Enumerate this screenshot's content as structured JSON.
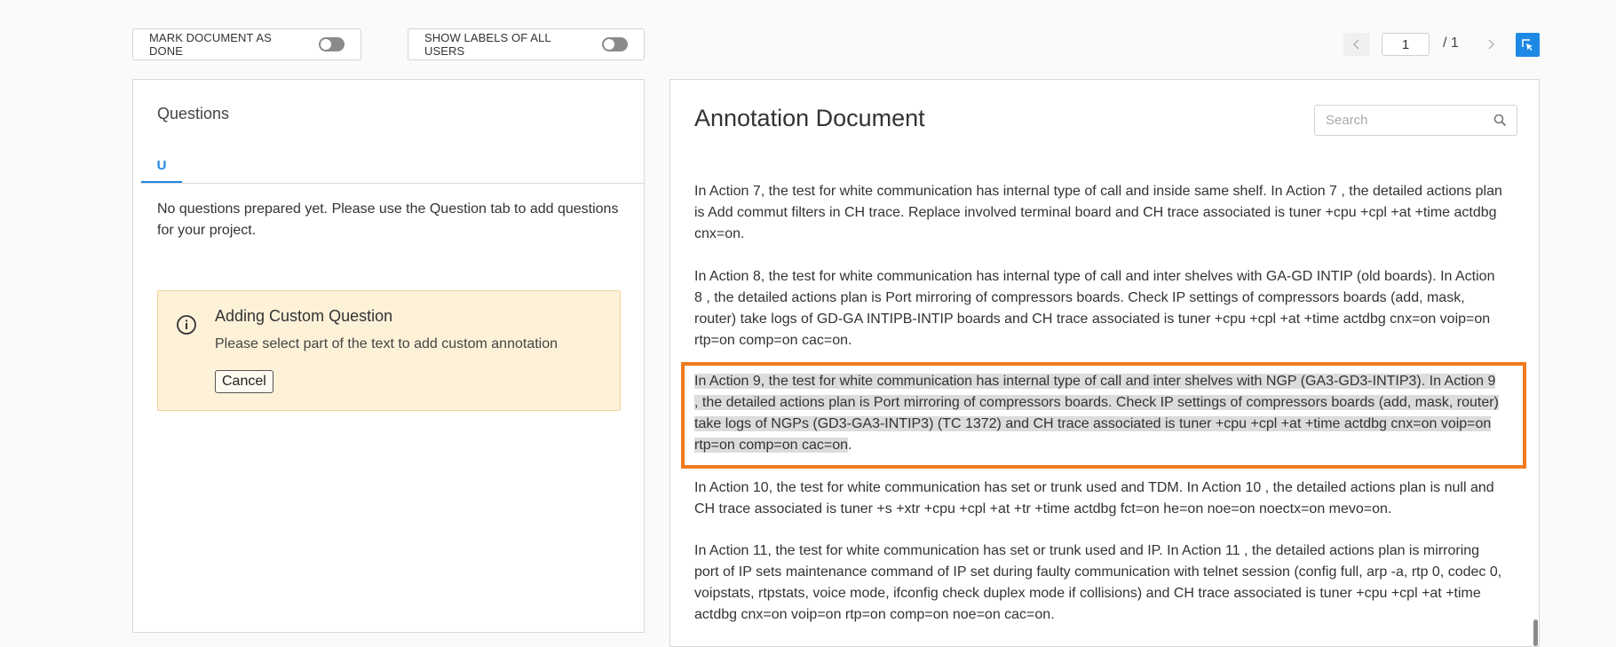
{
  "toolbar": {
    "mark_done_label": "MARK DOCUMENT AS DONE",
    "show_labels_label": "SHOW LABELS OF ALL USERS"
  },
  "pagination": {
    "current_page": "1",
    "total": "/ 1"
  },
  "questions_panel": {
    "title": "Questions",
    "tab_label": "U",
    "empty_message": "No questions prepared yet. Please use the Question tab to add questions for your project.",
    "custom_box": {
      "title": "Adding Custom Question",
      "description": "Please select part of the text to add custom annotation",
      "cancel_label": "Cancel"
    }
  },
  "document_panel": {
    "title": "Annotation Document",
    "search_placeholder": "Search",
    "paragraphs": [
      "In Action 7, the test for white communication has internal type of call and inside same shelf. In Action 7 , the detailed actions plan is Add commut filters in CH trace. Replace involved terminal board and CH trace associated is tuner +cpu +cpl +at +time actdbg cnx=on.",
      "In Action 8, the test for white communication has internal type of call and inter shelves with GA-GD INTIP (old boards). In Action 8 , the detailed actions plan is Port mirroring of compressors boards. Check IP settings of compressors boards (add, mask, router) take logs of GD-GA INTIPB-INTIP boards and CH trace associated is tuner +cpu +cpl +at +time actdbg cnx=on voip=on rtp=on comp=on cac=on.",
      "In Action 9, the test for white communication has internal type of call and inter shelves with NGP (GA3-GD3-INTIP3). In Action 9 , the detailed actions plan is Port mirroring of compressors boards. Check IP settings of compressors boards (add, mask, router) take logs of NGPs (GD3-GA3-INTIP3) (TC 1372) and CH trace associated is tuner +cpu +cpl +at +time actdbg cnx=on voip=on rtp=on comp=on cac=on",
      "In Action 10, the test for white communication has set or trunk used and TDM. In Action 10 , the detailed actions plan is null and CH trace associated is tuner +s +xtr +cpu +cpl +at +tr +time actdbg fct=on he=on noe=on noectx=on mevo=on.",
      "In Action 11, the test for white communication has set or trunk used and IP. In Action 11 , the detailed actions plan is mirroring port of IP sets maintenance command of IP set during faulty communication with telnet session (config full, arp -a, rtp 0, codec 0, voipstats, rtpstats, voice mode, ifconfig check duplex mode if collisions) and CH trace associated is tuner +cpu +cpl +at +time actdbg cnx=on voip=on rtp=on comp=on noe=on cac=on."
    ],
    "para9_trailing": "."
  },
  "colors": {
    "accent": "#1e88e5",
    "highlight_border": "#f07a1c",
    "selection": "#dcdcdc",
    "info_box_bg": "#fdf1d8"
  },
  "icons": [
    "chevron-left-icon",
    "chevron-right-icon",
    "select-area-icon",
    "info-icon",
    "search-icon"
  ]
}
